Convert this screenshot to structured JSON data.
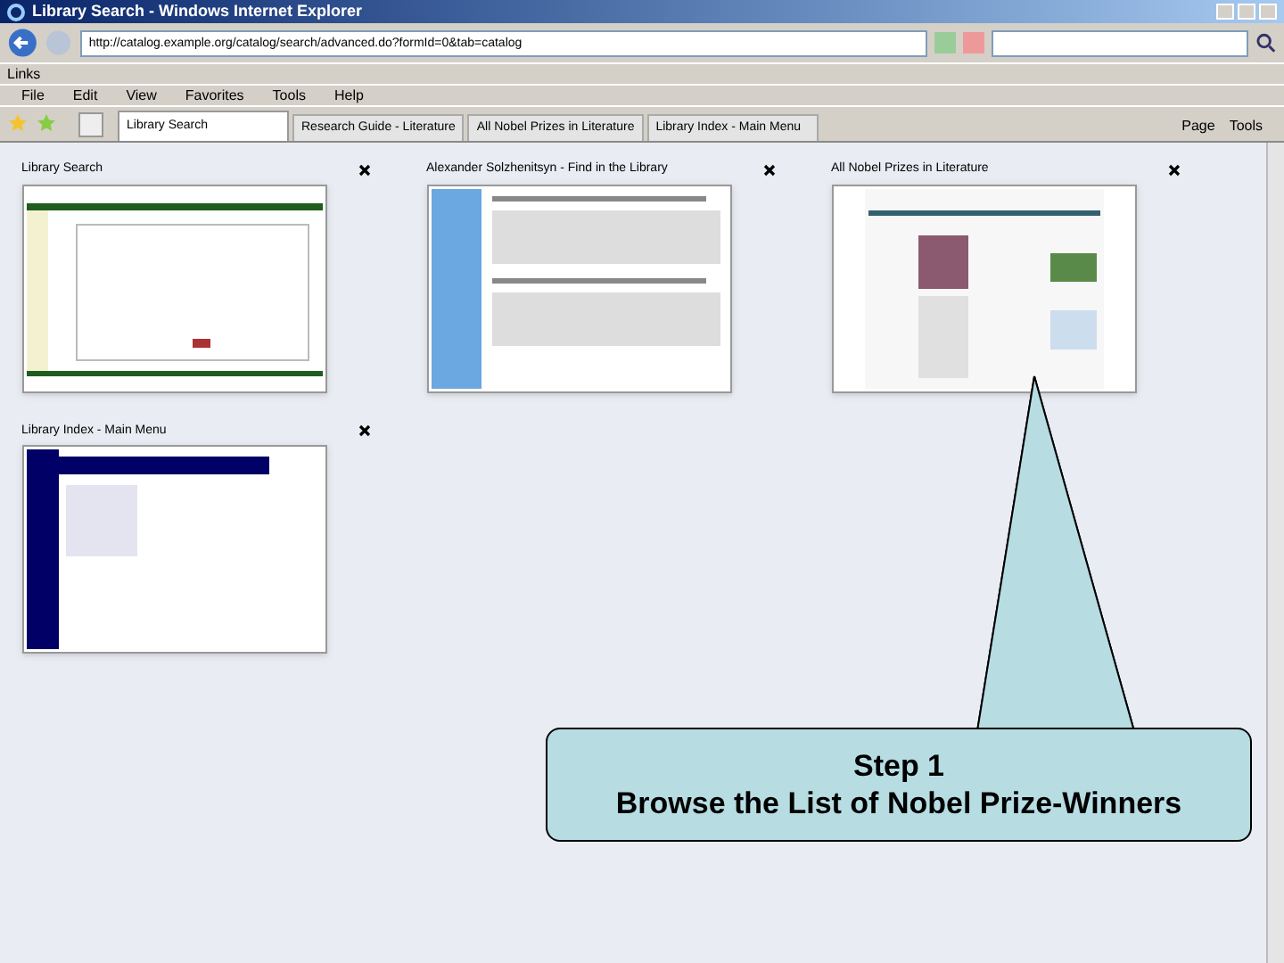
{
  "window": {
    "title": "Library Search - Windows Internet Explorer"
  },
  "address": "http://catalog.example.org/catalog/search/advanced.do?formId=0&tab=catalog",
  "links_label": "Links",
  "menu": [
    "File",
    "Edit",
    "View",
    "Favorites",
    "Tools",
    "Help"
  ],
  "tabs": [
    {
      "label": "Library Search",
      "selected": true
    },
    {
      "label": "Research Guide - Literature",
      "selected": false
    },
    {
      "label": "All Nobel Prizes in Literature",
      "selected": false
    },
    {
      "label": "Library Index - Main Menu",
      "selected": false
    }
  ],
  "toolbar": [
    "Page",
    "Tools"
  ],
  "quick_tabs": [
    {
      "title": "Library Search",
      "kind": "search"
    },
    {
      "title": "Alexander Solzhenitsyn - Find in the Library",
      "kind": "article"
    },
    {
      "title": "All Nobel Prizes in Literature",
      "kind": "nobel"
    },
    {
      "title": "Library Index - Main Menu",
      "kind": "index"
    }
  ],
  "callout": {
    "title": "Step 1",
    "text": "Browse the List of Nobel Prize-Winners"
  }
}
